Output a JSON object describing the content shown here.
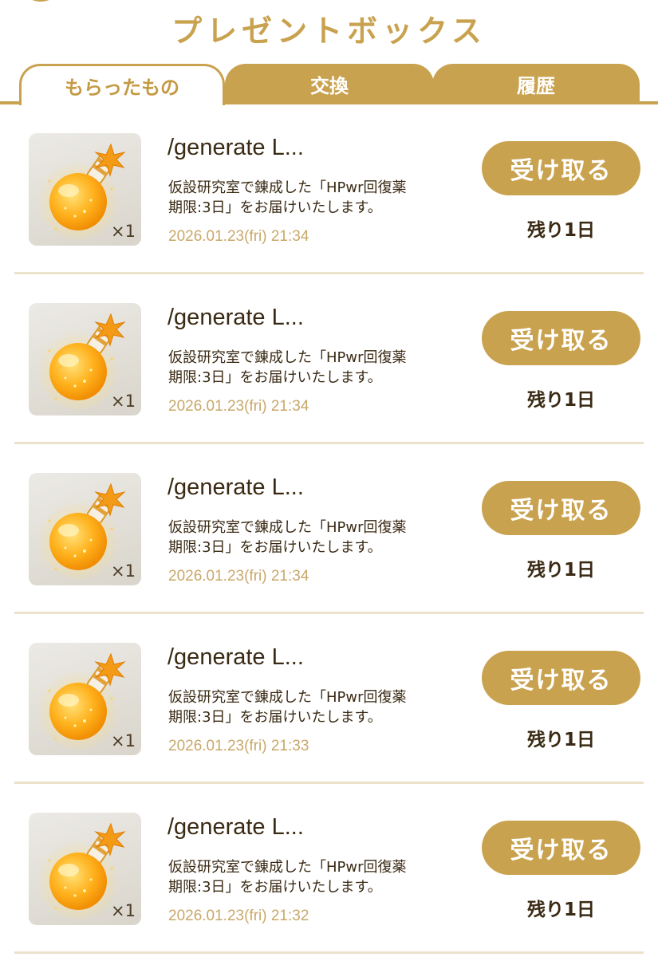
{
  "header": {
    "title": "プレゼントボックス"
  },
  "tabs": [
    {
      "label": "もらったもの",
      "active": true
    },
    {
      "label": "交換",
      "active": false
    },
    {
      "label": "履歴",
      "active": false
    }
  ],
  "colors": {
    "accent": "#c9a24f",
    "date_text": "#c9a86a",
    "divider": "#ece1cb"
  },
  "items": [
    {
      "icon": "potion-icon",
      "quantity": "×1",
      "title": "/generate L...",
      "description": "仮設研究室で錬成した「HPwr回復薬\n期限:3日」をお届けいたします。",
      "date": "2026.01.23(fri) 21:34",
      "button_label": "受け取る",
      "remaining": "残り1日"
    },
    {
      "icon": "potion-icon",
      "quantity": "×1",
      "title": "/generate L...",
      "description": "仮設研究室で錬成した「HPwr回復薬\n期限:3日」をお届けいたします。",
      "date": "2026.01.23(fri) 21:34",
      "button_label": "受け取る",
      "remaining": "残り1日"
    },
    {
      "icon": "potion-icon",
      "quantity": "×1",
      "title": "/generate L...",
      "description": "仮設研究室で錬成した「HPwr回復薬\n期限:3日」をお届けいたします。",
      "date": "2026.01.23(fri) 21:34",
      "button_label": "受け取る",
      "remaining": "残り1日"
    },
    {
      "icon": "potion-icon",
      "quantity": "×1",
      "title": "/generate L...",
      "description": "仮設研究室で錬成した「HPwr回復薬\n期限:3日」をお届けいたします。",
      "date": "2026.01.23(fri) 21:33",
      "button_label": "受け取る",
      "remaining": "残り1日"
    },
    {
      "icon": "potion-icon",
      "quantity": "×1",
      "title": "/generate L...",
      "description": "仮設研究室で錬成した「HPwr回復薬\n期限:3日」をお届けいたします。",
      "date": "2026.01.23(fri) 21:32",
      "button_label": "受け取る",
      "remaining": "残り1日"
    }
  ]
}
